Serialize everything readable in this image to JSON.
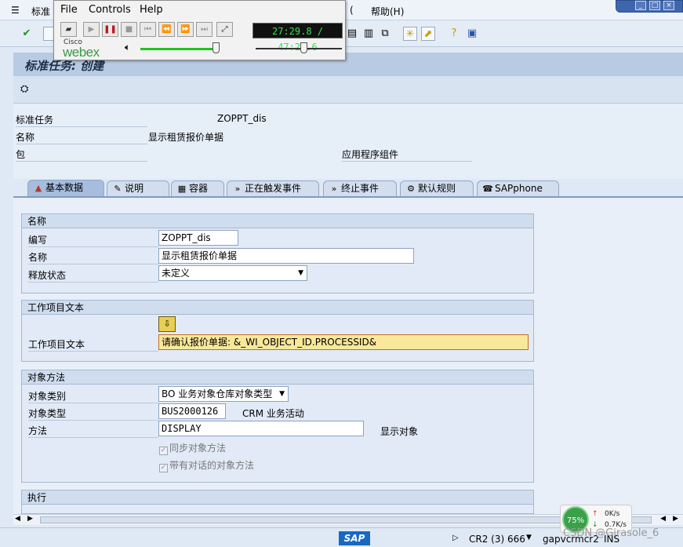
{
  "menubar": {
    "items_visible": [
      "标准",
      "(",
      "帮助(H)"
    ]
  },
  "webex": {
    "menu": [
      "File",
      "Controls",
      "Help"
    ],
    "time": "27:29.8 / 47:20.6",
    "logo_top": "Cisco",
    "logo_main": "webex"
  },
  "title": "标准任务: 创建",
  "header": {
    "task_label": "标准任务",
    "task_value": "ZOPPT_dis",
    "name_label": "名称",
    "name_value": "显示租赁报价单据",
    "package_label": "包",
    "app_component_label": "应用程序组件"
  },
  "tabs": [
    {
      "label": "基本数据",
      "icon": "basic-data-icon"
    },
    {
      "label": "说明",
      "icon": "description-icon"
    },
    {
      "label": "容器",
      "icon": "container-icon"
    },
    {
      "label": "正在触发事件",
      "icon": "triggering-event-icon"
    },
    {
      "label": "终止事件",
      "icon": "terminating-event-icon"
    },
    {
      "label": "默认规则",
      "icon": "default-rules-icon"
    },
    {
      "label": "SAPphone",
      "icon": "sapphone-icon"
    }
  ],
  "group_name": {
    "title": "名称",
    "abbr_label": "编写",
    "abbr_value": "ZOPPT_dis",
    "name_label": "名称",
    "name_value": "显示租赁报价单据",
    "release_label": "释放状态",
    "release_value": "未定义"
  },
  "group_workitem": {
    "title": "工作项目文本",
    "label": "工作项目文本",
    "value": "请确认报价单据: &_WI_OBJECT_ID.PROCESSID&"
  },
  "group_object": {
    "title": "对象方法",
    "category_label": "对象类别",
    "category_value": "BO 业务对象仓库对象类型",
    "type_label": "对象类型",
    "type_value": "BUS2000126",
    "type_desc": "CRM 业务活动",
    "method_label": "方法",
    "method_value": "DISPLAY",
    "method_desc": "显示对象",
    "sync_label": "同步对象方法",
    "dialog_label": "带有对话的对象方法"
  },
  "group_exec": {
    "title": "执行"
  },
  "status": {
    "sap_logo": "SAP",
    "system": "CR2 (3) 666",
    "server": "gapvcrmcr2",
    "mode": "INS"
  },
  "net": {
    "percent": "75%",
    "up": "0K/s",
    "down": "0.7K/s"
  },
  "watermark": "CSDN @Girasole_6"
}
